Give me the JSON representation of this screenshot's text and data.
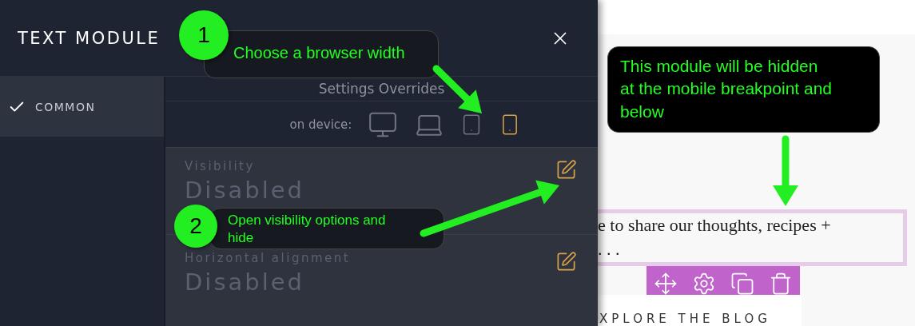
{
  "panel": {
    "title": "TEXT MODULE",
    "sidebar": {
      "items": [
        {
          "label": "COMMON",
          "selected": true
        }
      ]
    },
    "overrides_title": "Settings Overrides",
    "device_label": "on device:",
    "devices": [
      {
        "kind": "desktop",
        "selected": false
      },
      {
        "kind": "laptop",
        "selected": false
      },
      {
        "kind": "tablet",
        "selected": false
      },
      {
        "kind": "phone",
        "selected": true
      }
    ],
    "settings": [
      {
        "label": "Visibility",
        "value": "Disabled"
      },
      {
        "label": "Horizontal alignment",
        "value": "Disabled"
      }
    ]
  },
  "preview": {
    "text_lines": [
      "e to share our thoughts, recipes +",
      ". . ."
    ],
    "toolbar": [
      {
        "kind": "move"
      },
      {
        "kind": "settings"
      },
      {
        "kind": "copy"
      },
      {
        "kind": "delete"
      }
    ],
    "heading": "XPLORE THE BLOG"
  },
  "annotations": [
    {
      "number": "1",
      "text": "Choose a browser width"
    },
    {
      "number": "2",
      "text": "Open visibility options and hide"
    },
    {
      "text": "This module will be hidden at the mobile breakpoint and below"
    }
  ]
}
